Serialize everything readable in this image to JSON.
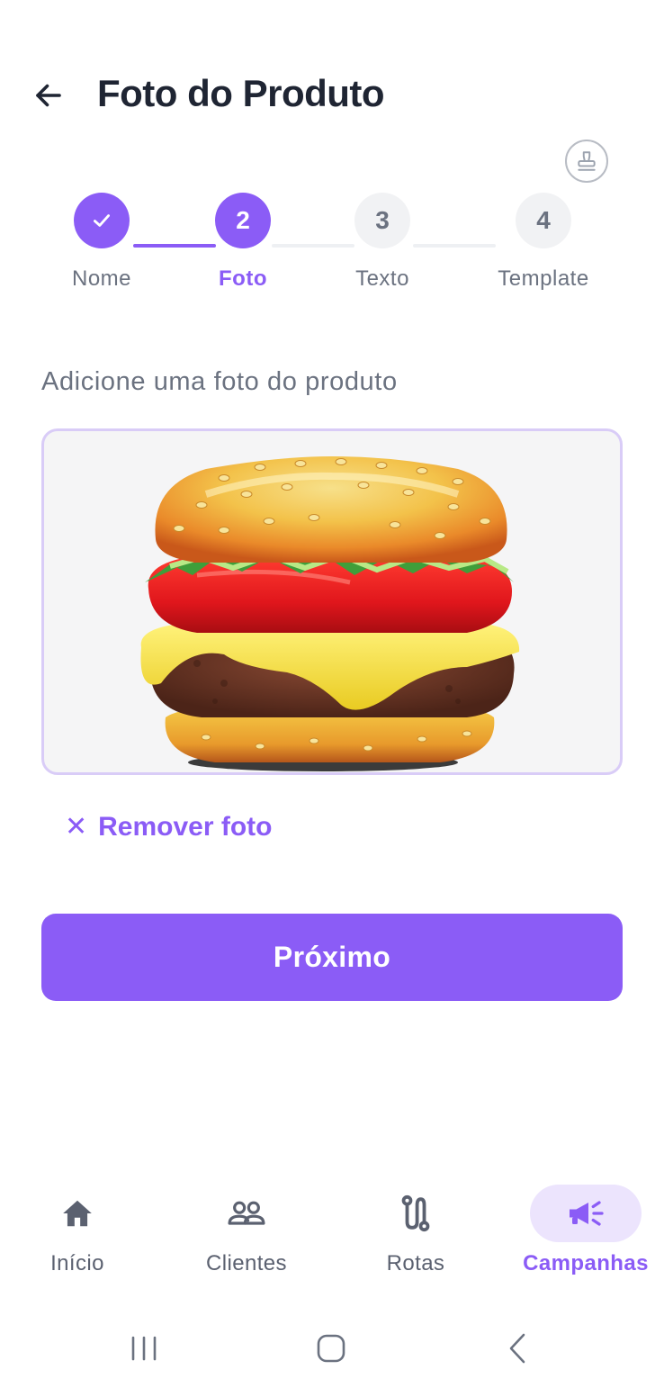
{
  "header": {
    "title": "Foto do Produto",
    "back_icon": "arrow-left-icon",
    "stamp_icon": "stamp-icon"
  },
  "stepper": {
    "current_step": 2,
    "steps": [
      {
        "number": "1",
        "label": "Nome",
        "state": "done"
      },
      {
        "number": "2",
        "label": "Foto",
        "state": "active"
      },
      {
        "number": "3",
        "label": "Texto",
        "state": "pending"
      },
      {
        "number": "4",
        "label": "Template",
        "state": "pending"
      }
    ]
  },
  "content": {
    "prompt": "Adicione uma foto do produto",
    "image_subject": "hamburger",
    "remove_label": "Remover foto",
    "next_label": "Próximo"
  },
  "bottom_nav": {
    "items": [
      {
        "label": "Início",
        "icon": "home-icon"
      },
      {
        "label": "Clientes",
        "icon": "users-icon"
      },
      {
        "label": "Rotas",
        "icon": "route-icon"
      },
      {
        "label": "Campanhas",
        "icon": "megaphone-icon",
        "active": true
      }
    ]
  },
  "colors": {
    "accent": "#8b5cf6",
    "accent_light": "#ece4fd",
    "text_dark": "#1f2533",
    "text_muted": "#6b7280"
  }
}
